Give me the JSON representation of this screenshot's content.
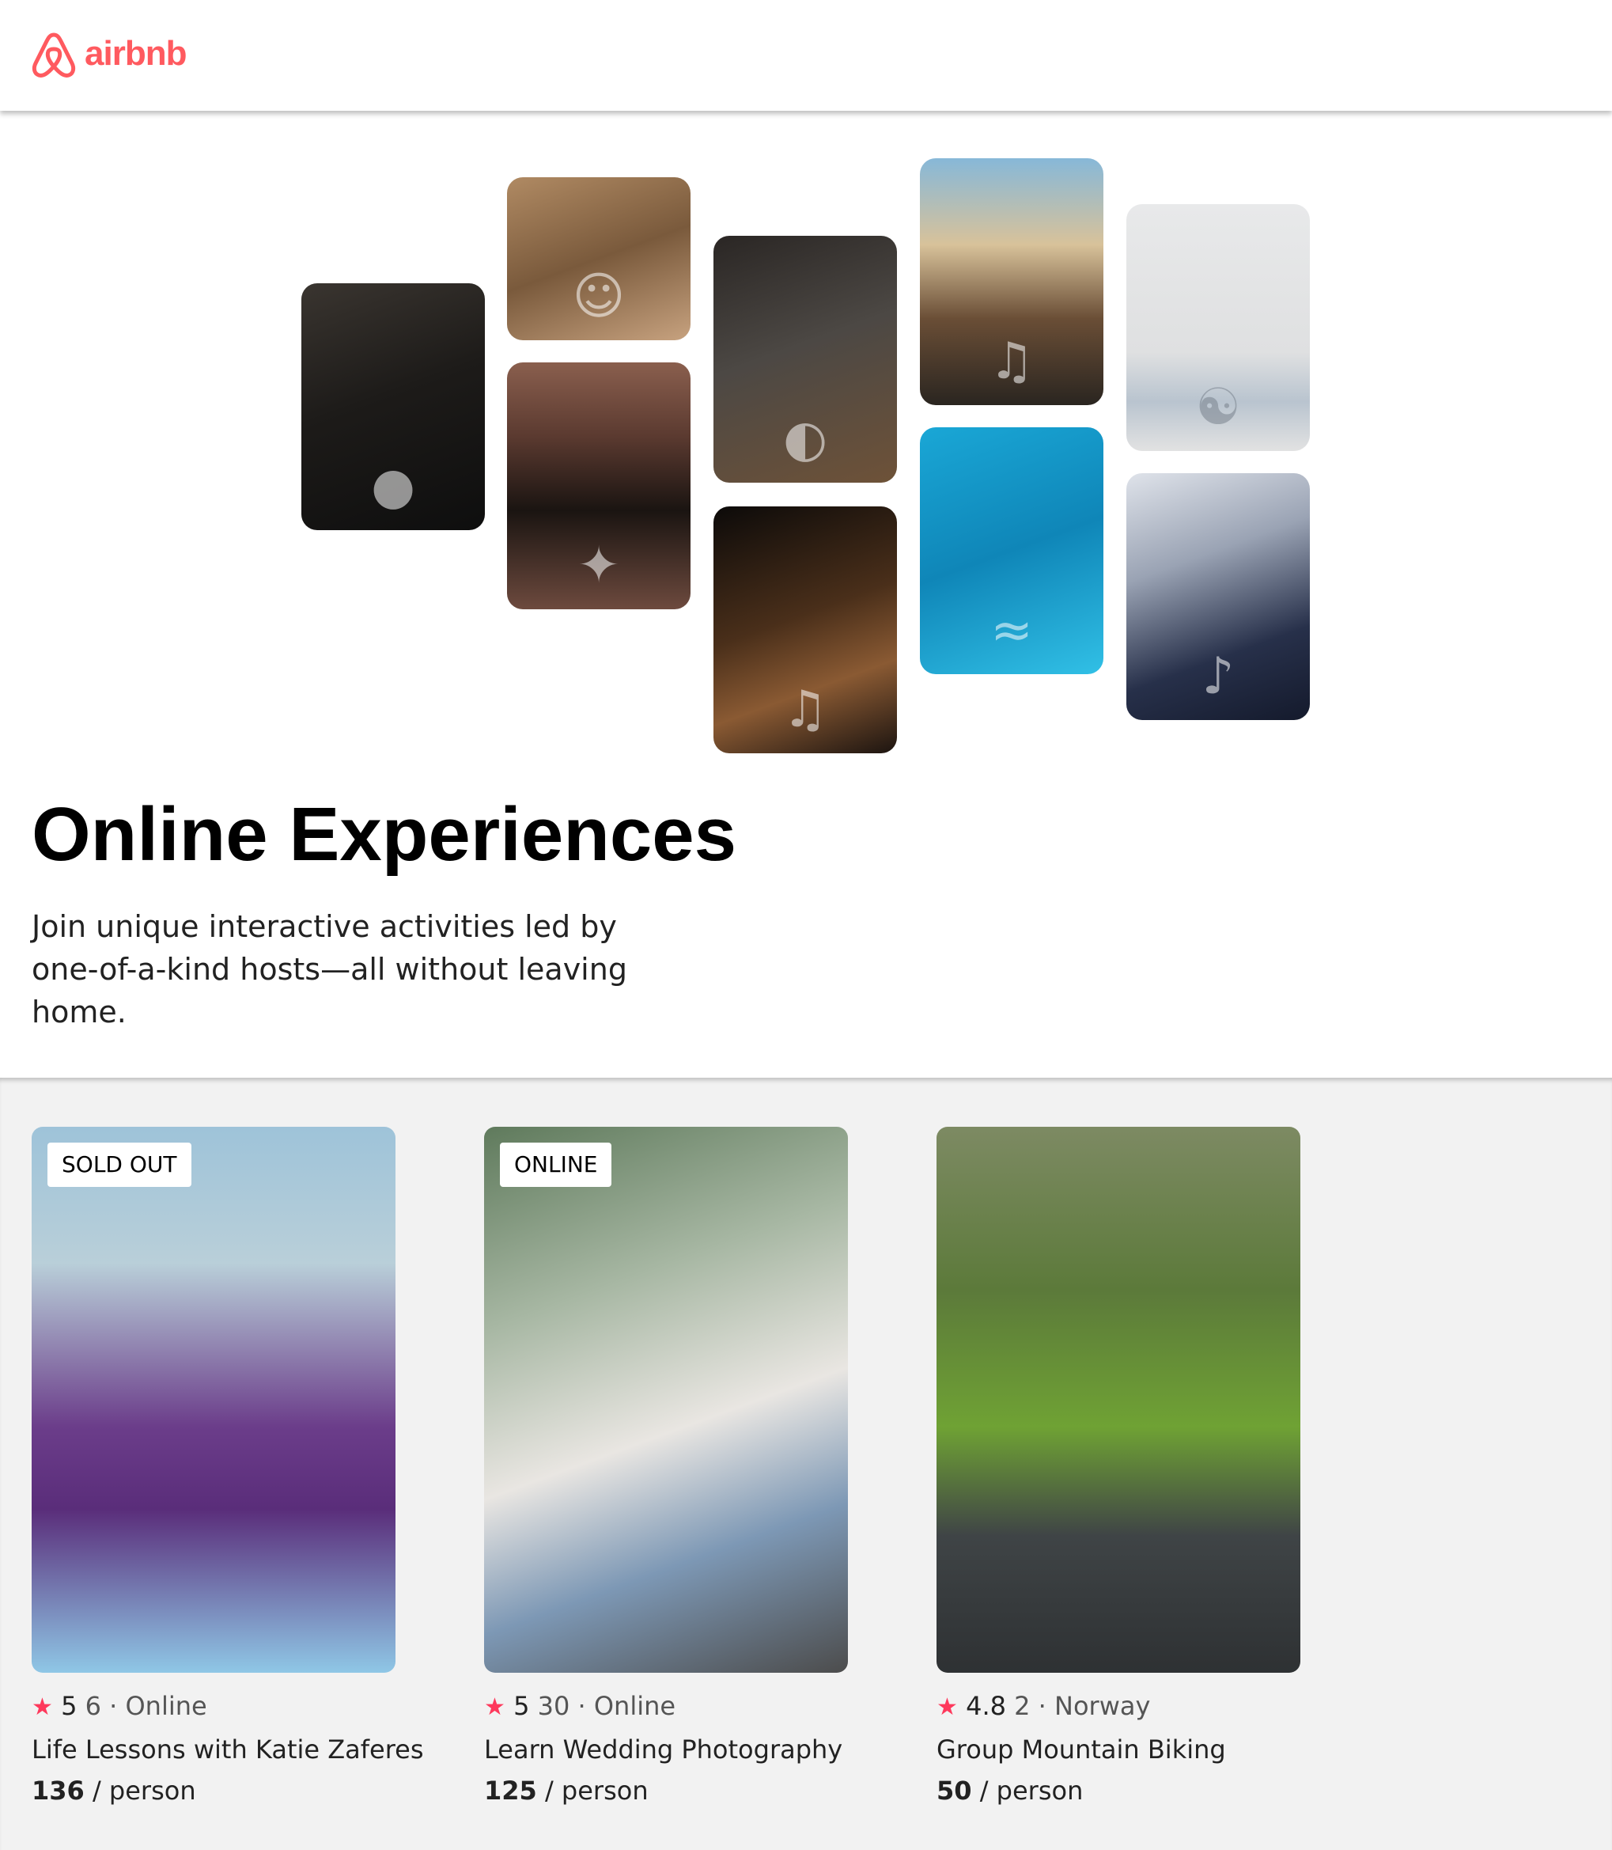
{
  "navbar": {
    "logo_text": "airbnb",
    "logo_icon": "airbnb-belo-icon",
    "brand_color": "#ff5a5f"
  },
  "hero": {
    "title": "Online Experiences",
    "subtitle": "Join unique interactive activities led by one-of-a-kind hosts—all without leaving home.",
    "photos": [
      {
        "name": "cooking-pans-photo",
        "icon": "pan-icon"
      },
      {
        "name": "baker-macarons-photo",
        "icon": "person-icon"
      },
      {
        "name": "dancer-doorway-photo",
        "icon": "dancer-icon"
      },
      {
        "name": "bowl-garnish-photo",
        "icon": "bowl-icon"
      },
      {
        "name": "acoustic-guitar-photo",
        "icon": "guitar-icon"
      },
      {
        "name": "piano-microphone-photo",
        "icon": "microphone-icon"
      },
      {
        "name": "swimmer-pool-photo",
        "icon": "swimmer-icon"
      },
      {
        "name": "yoga-meditation-photo",
        "icon": "yoga-icon"
      },
      {
        "name": "singer-microphone-photo",
        "icon": "singer-icon"
      }
    ]
  },
  "cards": [
    {
      "badge": "SOLD OUT",
      "star": "★",
      "rating": "5",
      "reviews": "6",
      "separator": "·",
      "location": "Online",
      "title": "Life Lessons with Katie Zaferes",
      "price": "136",
      "price_unit": "/ person",
      "image": "runner-marathon-photo"
    },
    {
      "badge": "ONLINE",
      "star": "★",
      "rating": "5",
      "reviews": "30",
      "separator": "·",
      "location": "Online",
      "title": "Learn Wedding Photography",
      "price": "125",
      "price_unit": "/ person",
      "image": "wedding-couple-photo"
    },
    {
      "badge": "",
      "star": "★",
      "rating": "4.8",
      "reviews": "2",
      "separator": "·",
      "location": "Norway",
      "title": "Group Mountain Biking",
      "price": "50",
      "price_unit": "/ person",
      "image": "mountain-cyclist-photo"
    }
  ],
  "colors": {
    "star": "#fe395c",
    "cards_background": "#f2f2f2"
  }
}
